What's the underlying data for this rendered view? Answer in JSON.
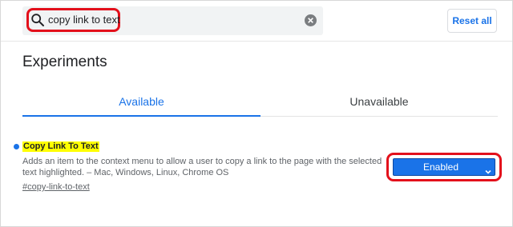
{
  "search": {
    "value": "copy link to text",
    "icon": "search-icon",
    "clear_icon": "clear-icon"
  },
  "header": {
    "reset_label": "Reset all"
  },
  "page": {
    "title": "Experiments"
  },
  "tabs": [
    {
      "label": "Available",
      "active": true
    },
    {
      "label": "Unavailable",
      "active": false
    }
  ],
  "experiment": {
    "title": "Copy Link To Text",
    "description": "Adds an item to the context menu to allow a user to copy a link to the page with the selected text highlighted. – Mac, Windows, Linux, Chrome OS",
    "link": "#copy-link-to-text",
    "selected_option": "Enabled"
  },
  "colors": {
    "accent": "#1a73e8",
    "highlight_outline": "#e3101b",
    "title_highlight": "#ffff00"
  }
}
